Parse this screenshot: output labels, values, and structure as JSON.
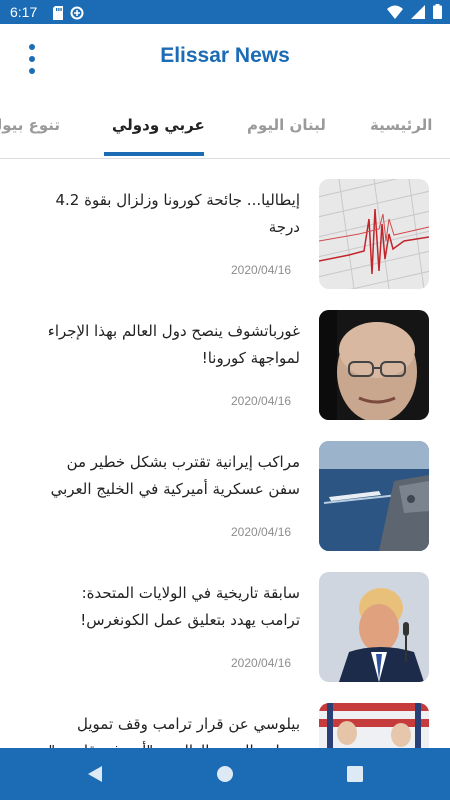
{
  "status_bar": {
    "time": "6:17",
    "icons": [
      "sd-card-icon",
      "data-saver-icon",
      "wifi-icon",
      "signal-icon",
      "battery-icon"
    ]
  },
  "app_bar": {
    "title": "Elissar News",
    "menu_icon": "more-vert-icon"
  },
  "tabs": [
    {
      "label": "الرئيسية",
      "active": false
    },
    {
      "label": "لبنان اليوم",
      "active": false
    },
    {
      "label": "عربي ودولي",
      "active": true
    },
    {
      "label": "تنوع بيولوجي",
      "active": false
    }
  ],
  "news": [
    {
      "headline": "إيطاليا... جائحة كورونا وزلزال بقوة 4.2 درجة",
      "date": "2020/04/16",
      "image": "seismograph"
    },
    {
      "headline": "غورباتشوف ينصح دول العالم بهذا الإجراء لمواجهة كورونا!",
      "date": "2020/04/16",
      "image": "gorbachev-portrait"
    },
    {
      "headline": "مراكب إيرانية تقترب بشكل خطير من سفن عسكرية أميركية في الخليج العربي",
      "date": "2020/04/16",
      "image": "boats-at-sea"
    },
    {
      "headline": "سابقة تاريخية في الولايات المتحدة: ترامب يهدد بتعليق عمل الكونغرس!",
      "date": "2020/04/16",
      "image": "trump-portrait"
    },
    {
      "headline": "بيلوسي عن قرار ترامب وقف تمويل منظمة الصحة العالمية: \"أمر غير قانوني\"",
      "date": "",
      "image": "congress-hall"
    }
  ],
  "nav_bar": {
    "buttons": [
      "back-icon",
      "home-icon",
      "recents-icon"
    ]
  },
  "colors": {
    "primary": "#1b6bb5",
    "text": "#222222",
    "muted": "#8e8e8e"
  }
}
